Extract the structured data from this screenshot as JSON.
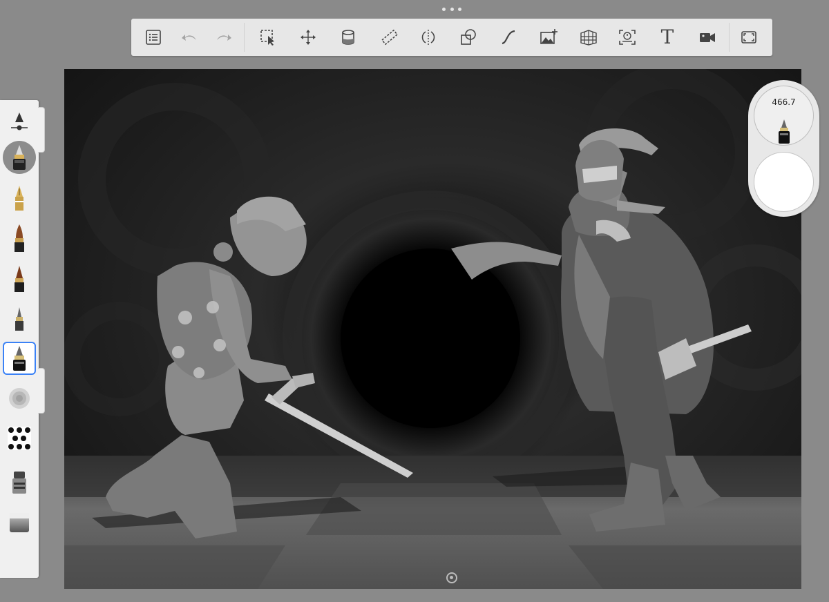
{
  "toolbar": {
    "items": [
      {
        "name": "brush-library",
        "icon": "list-icon"
      },
      {
        "name": "undo",
        "icon": "undo-icon"
      },
      {
        "name": "redo",
        "icon": "redo-icon"
      },
      {
        "name": "selection",
        "icon": "selection-icon"
      },
      {
        "name": "transform",
        "icon": "move-icon"
      },
      {
        "name": "fill",
        "icon": "paint-bucket-icon"
      },
      {
        "name": "ruler",
        "icon": "ruler-icon"
      },
      {
        "name": "symmetry",
        "icon": "symmetry-icon"
      },
      {
        "name": "shapes",
        "icon": "shapes-icon"
      },
      {
        "name": "stroke",
        "icon": "curve-icon"
      },
      {
        "name": "import-image",
        "icon": "image-add-icon"
      },
      {
        "name": "perspective",
        "icon": "perspective-grid-icon"
      },
      {
        "name": "time-lapse",
        "icon": "timelapse-icon"
      },
      {
        "name": "text",
        "icon": "text-icon",
        "label": "T"
      },
      {
        "name": "record",
        "icon": "video-icon"
      },
      {
        "name": "fullscreen",
        "icon": "fullscreen-icon"
      }
    ]
  },
  "brush_size": "466.7",
  "current_color": "#ffffff",
  "brushes": [
    "size-opacity-slider",
    "ink-pen",
    "fountain-pen",
    "paint-brush",
    "marker",
    "fine-pen",
    "technical-pen",
    "airbrush",
    "pattern",
    "smudge",
    "eraser"
  ]
}
